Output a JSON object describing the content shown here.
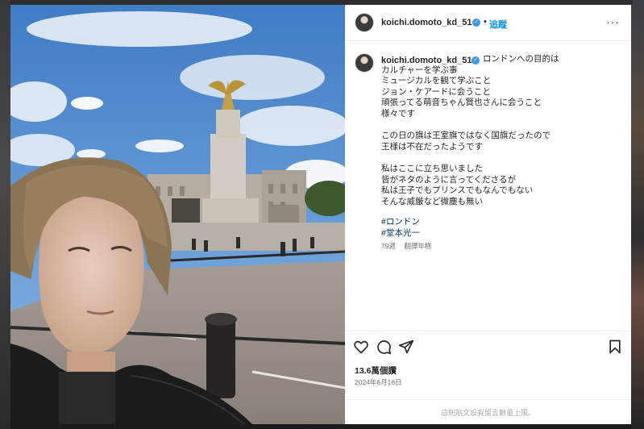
{
  "post": {
    "username": "koichi.domoto_kd_51",
    "follow_label": "追蹤",
    "separator": "•",
    "more_label": "···",
    "caption_lines": [
      "ロンドンへの目的は",
      "カルチャーを学ぶ事",
      "ミュージカルを観て学ぶこと",
      "ジョン・ケアードに会うこと",
      "頑張ってる萌音ちゃん賢也さんに会うこと",
      "様々です",
      "",
      "この日の旗は王室旗ではなく国旗だったので",
      "王様は不在だったようです",
      "",
      "私はここに立ち思いました",
      "皆がネタのように言ってくださるが",
      "私は王子でもプリンスでもなんでもない",
      "そんな威厳など微塵も無い"
    ],
    "hashtags": [
      "#ロンドン",
      "#堂本光一"
    ],
    "age": "79週",
    "translate_label": "翻譯年糕",
    "likes": "13.6萬個讚",
    "date": "2024年6月16日",
    "comments_disabled": "這則貼文設有留言數量上限。"
  },
  "icons": {
    "like": "heart-icon",
    "comment": "comment-icon",
    "share": "share-icon",
    "save": "bookmark-icon",
    "verified": "verified-badge-icon"
  },
  "colors": {
    "link_blue": "#0095f6",
    "hashtag": "#00376b",
    "verified": "#3897f0"
  }
}
